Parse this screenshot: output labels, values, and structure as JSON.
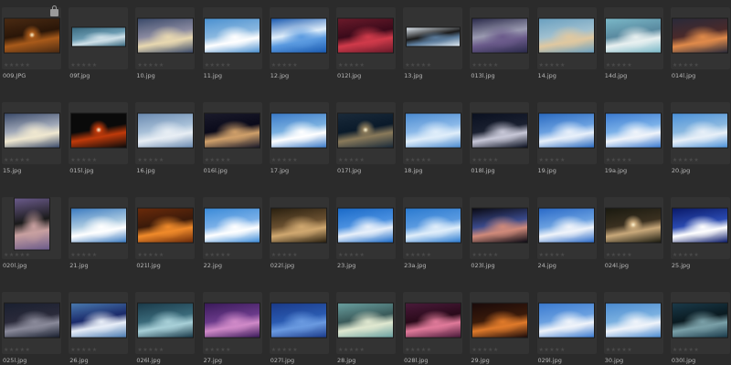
{
  "rating_glyph": "★★★★★",
  "lock_glyph": "🔒",
  "rows": [
    [
      {
        "name": "009.JPG",
        "orient": "land",
        "locked": true,
        "c1": "#4a2a12",
        "c2": "#a85a1a",
        "c3": "#2a1608",
        "sun": true
      },
      {
        "name": "09f.jpg",
        "orient": "pano",
        "c1": "#3a6a80",
        "c2": "#cfe0e8",
        "c3": "#6a9ab0"
      },
      {
        "name": "10.jpg",
        "orient": "land",
        "c1": "#3a4a6a",
        "c2": "#e8d8b0",
        "c3": "#8a8aa0"
      },
      {
        "name": "11.jpg",
        "orient": "land",
        "c1": "#4a90d0",
        "c2": "#ffffff",
        "c3": "#8ab8e0"
      },
      {
        "name": "12.jpg",
        "orient": "land",
        "c1": "#1a5ab0",
        "c2": "#5a9ae0",
        "c3": "#e0eefa"
      },
      {
        "name": "012l.jpg",
        "orient": "land",
        "c1": "#6a1a2a",
        "c2": "#d03a4a",
        "c3": "#3a0a1a"
      },
      {
        "name": "13.jpg",
        "orient": "pano",
        "c1": "#dfe8f0",
        "c2": "#5a7a9a",
        "c3": "#1a1a1a"
      },
      {
        "name": "013l.jpg",
        "orient": "land",
        "c1": "#2a2a4a",
        "c2": "#6a5a8a",
        "c3": "#9a9ab0"
      },
      {
        "name": "14.jpg",
        "orient": "land",
        "c1": "#6aa0c0",
        "c2": "#e0c8a0",
        "c3": "#a0c0d0"
      },
      {
        "name": "14d.jpg",
        "orient": "land",
        "c1": "#7ab8c8",
        "c2": "#e8f0f0",
        "c3": "#5a8aa0"
      },
      {
        "name": "014l.jpg",
        "orient": "land",
        "c1": "#2a2a3a",
        "c2": "#e08a4a",
        "c3": "#4a2a2a"
      }
    ],
    [
      {
        "name": "15.jpg",
        "orient": "land",
        "c1": "#3a4a6a",
        "c2": "#f0e8d0",
        "c3": "#a0a8b8"
      },
      {
        "name": "015l.jpg",
        "orient": "land",
        "c1": "#0a0a0a",
        "c2": "#c03a0a",
        "c3": "#0a0a0a",
        "sun": true
      },
      {
        "name": "16.jpg",
        "orient": "land",
        "c1": "#6a8ab0",
        "c2": "#e8eef4",
        "c3": "#a8c0d8"
      },
      {
        "name": "016l.jpg",
        "orient": "land",
        "c1": "#1a1a2a",
        "c2": "#d0a06a",
        "c3": "#0a0a1a"
      },
      {
        "name": "17.jpg",
        "orient": "land",
        "c1": "#3a7ac8",
        "c2": "#ffffff",
        "c3": "#7ab0e0"
      },
      {
        "name": "017l.jpg",
        "orient": "land",
        "c1": "#1a2a3a",
        "c2": "#8a7a5a",
        "c3": "#0a1a2a",
        "sun": true
      },
      {
        "name": "18.jpg",
        "orient": "land",
        "c1": "#4a8ad0",
        "c2": "#e0eefa",
        "c3": "#8ab8e8"
      },
      {
        "name": "018l.jpg",
        "orient": "land",
        "c1": "#0a1020",
        "c2": "#c8c8d8",
        "c3": "#1a2030"
      },
      {
        "name": "19.jpg",
        "orient": "land",
        "c1": "#2a6ac0",
        "c2": "#e8f0fa",
        "c3": "#6aa0e0"
      },
      {
        "name": "19a.jpg",
        "orient": "land",
        "c1": "#3a7ad0",
        "c2": "#f0f4fa",
        "c3": "#7ab0e8"
      },
      {
        "name": "20.jpg",
        "orient": "land",
        "c1": "#4a90d8",
        "c2": "#e8f0f8",
        "c3": "#8ab8e0"
      }
    ],
    [
      {
        "name": "020l.jpg",
        "orient": "port",
        "c1": "#6a5a8a",
        "c2": "#c8a0a0",
        "c3": "#1a1a1a"
      },
      {
        "name": "21.jpg",
        "orient": "land",
        "c1": "#3a7ac0",
        "c2": "#ffffff",
        "c3": "#a8c8e0"
      },
      {
        "name": "021l.jpg",
        "orient": "land",
        "c1": "#6a2a0a",
        "c2": "#f08a2a",
        "c3": "#3a1a0a"
      },
      {
        "name": "22.jpg",
        "orient": "land",
        "c1": "#3a8ad8",
        "c2": "#ffffff",
        "c3": "#7ab0e8"
      },
      {
        "name": "022l.jpg",
        "orient": "land",
        "c1": "#2a2010",
        "c2": "#d0a870",
        "c3": "#6a5030"
      },
      {
        "name": "23.jpg",
        "orient": "land",
        "c1": "#1a6ac8",
        "c2": "#e8f0fa",
        "c3": "#4a90e0"
      },
      {
        "name": "23a.jpg",
        "orient": "land",
        "c1": "#2a7ad0",
        "c2": "#e0eefa",
        "c3": "#5a9ae0"
      },
      {
        "name": "023l.jpg",
        "orient": "land",
        "c1": "#0a0a14",
        "c2": "#d08a7a",
        "c3": "#3a4a8a"
      },
      {
        "name": "24.jpg",
        "orient": "land",
        "c1": "#2a6ac8",
        "c2": "#f0f4fa",
        "c3": "#6aa0e0"
      },
      {
        "name": "024l.jpg",
        "orient": "land",
        "c1": "#1a1a10",
        "c2": "#c8a87a",
        "c3": "#3a3020",
        "sun": true
      },
      {
        "name": "25.jpg",
        "orient": "land",
        "c1": "#0a1a6a",
        "c2": "#ffffff",
        "c3": "#2a4ab0"
      }
    ],
    [
      {
        "name": "025l.jpg",
        "orient": "land",
        "c1": "#1a2030",
        "c2": "#8a8a9a",
        "c3": "#2a2a3a"
      },
      {
        "name": "26.jpg",
        "orient": "land",
        "c1": "#4a7ab0",
        "c2": "#e8eef8",
        "c3": "#1a2a6a"
      },
      {
        "name": "026l.jpg",
        "orient": "land",
        "c1": "#1a3a4a",
        "c2": "#a8d0d8",
        "c3": "#3a6a7a"
      },
      {
        "name": "27.jpg",
        "orient": "land",
        "c1": "#3a1a5a",
        "c2": "#d08ac8",
        "c3": "#6a3a8a"
      },
      {
        "name": "027l.jpg",
        "orient": "land",
        "c1": "#1a3a8a",
        "c2": "#6a9ae0",
        "c3": "#2a5ab0"
      },
      {
        "name": "28.jpg",
        "orient": "land",
        "c1": "#6aa0a0",
        "c2": "#e0e8d0",
        "c3": "#3a5a5a"
      },
      {
        "name": "028l.jpg",
        "orient": "land",
        "c1": "#4a1a3a",
        "c2": "#e07a9a",
        "c3": "#2a0a1a"
      },
      {
        "name": "29.jpg",
        "orient": "land",
        "c1": "#1a0a0a",
        "c2": "#e07a2a",
        "c3": "#3a1a0a"
      },
      {
        "name": "029l.jpg",
        "orient": "land",
        "c1": "#3a7ad0",
        "c2": "#f0f4fa",
        "c3": "#6aa0e0"
      },
      {
        "name": "30.jpg",
        "orient": "land",
        "c1": "#4a8ad0",
        "c2": "#f0f4fa",
        "c3": "#7ab0e0"
      },
      {
        "name": "030l.jpg",
        "orient": "land",
        "c1": "#1a3a4a",
        "c2": "#7aa0a8",
        "c3": "#0a1a20"
      }
    ]
  ]
}
